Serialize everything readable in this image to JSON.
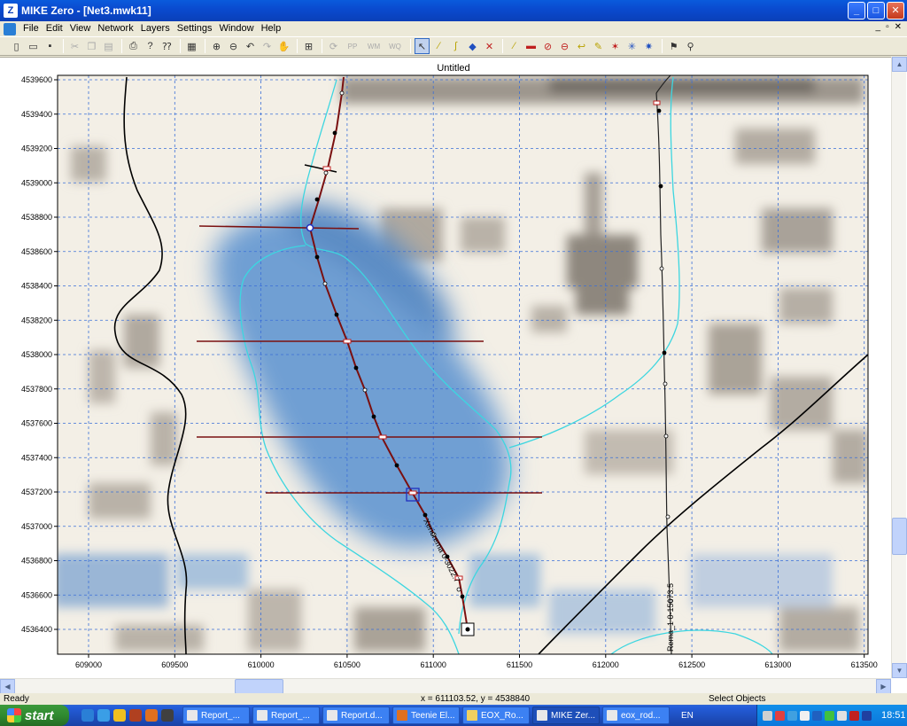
{
  "window": {
    "title": "MIKE Zero - [Net3.mwk11]",
    "minimize": "_",
    "maximize": "□",
    "close": "✕"
  },
  "menu": [
    "File",
    "Edit",
    "View",
    "Network",
    "Layers",
    "Settings",
    "Window",
    "Help"
  ],
  "mdi_controls": [
    "_",
    "▫",
    "✕"
  ],
  "toolbar": {
    "pp_label": "PP",
    "wm_label": "WM",
    "wq_label": "WQ"
  },
  "document": {
    "title": "Untitled"
  },
  "map": {
    "y_ticks": [
      "4539600",
      "4539400",
      "4539200",
      "4539000",
      "4538800",
      "4538600",
      "4538400",
      "4538200",
      "4538000",
      "4537800",
      "4537600",
      "4537400",
      "4537200",
      "4537000",
      "4536800",
      "4536600",
      "4536400"
    ],
    "x_ticks": [
      "609000",
      "609500",
      "610000",
      "610500",
      "611000",
      "611500",
      "612000",
      "612500",
      "613000",
      "613500"
    ],
    "branch_label_1": "Xeriorema 0-3022.7",
    "branch_label_2": "Rema_1 0-15673.5",
    "colors": {
      "grid": "#3a6fd8",
      "river": "#7a1010",
      "cross_section": "#7a1010",
      "flood_outline": "#3cd6e0",
      "road": "#000000",
      "water": "#7fb0e0"
    }
  },
  "status": {
    "left": "Ready",
    "coords": "x = 611103.52, y = 4538840",
    "mode": "Select Objects"
  },
  "taskbar": {
    "start": "start",
    "tasks": [
      "Report_...",
      "Report_...",
      "Report.d...",
      "Teenie El...",
      "EOX_Ro...",
      "MIKE Zer...",
      "eox_rod..."
    ],
    "language": "EN",
    "clock": "18:51"
  }
}
